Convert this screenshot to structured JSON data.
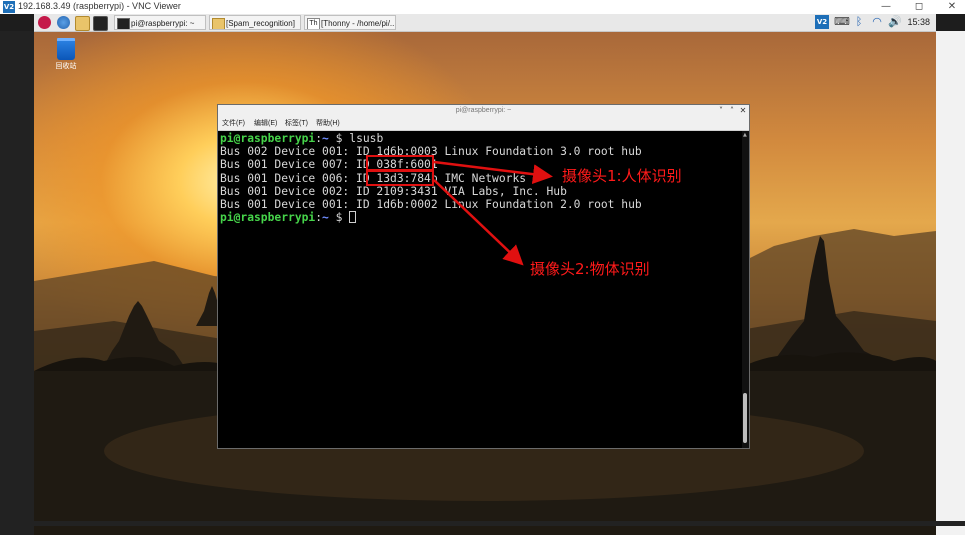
{
  "vnc": {
    "title": "192.168.3.49 (raspberrypi) - VNC Viewer",
    "logo": "V2",
    "minimize": "—",
    "maximize": "◻",
    "close": "✕"
  },
  "taskbar": {
    "items": [
      {
        "label": "pi@raspberrypi: ~"
      },
      {
        "label": "[Spam_recognition]"
      },
      {
        "label": "[Thonny - /home/pi/..."
      }
    ],
    "clock": "15:38",
    "tray_vnc_label": "V2"
  },
  "desktop": {
    "trash_label": "回收站"
  },
  "terminal": {
    "title": "pi@raspberrypi: ~",
    "menu": [
      "文件(F)",
      "编辑(E)",
      "标签(T)",
      "帮助(H)"
    ],
    "prompt_user": "pi@raspberrypi",
    "prompt_path": "~",
    "prompt_symbol": "$",
    "command": "lsusb",
    "lines": [
      "Bus 002 Device 001: ID 1d6b:0003 Linux Foundation 3.0 root hub",
      "Bus 001 Device 007: ID 038f:6001",
      "Bus 001 Device 006: ID 13d3:784b IMC Networks",
      "Bus 001 Device 002: ID 2109:3431 VIA Labs, Inc. Hub",
      "Bus 001 Device 001: ID 1d6b:0002 Linux Foundation 2.0 root hub"
    ]
  },
  "annotations": {
    "camera1": "摄像头1:人体识别",
    "camera2": "摄像头2:物体识别",
    "color": "#e01010"
  }
}
